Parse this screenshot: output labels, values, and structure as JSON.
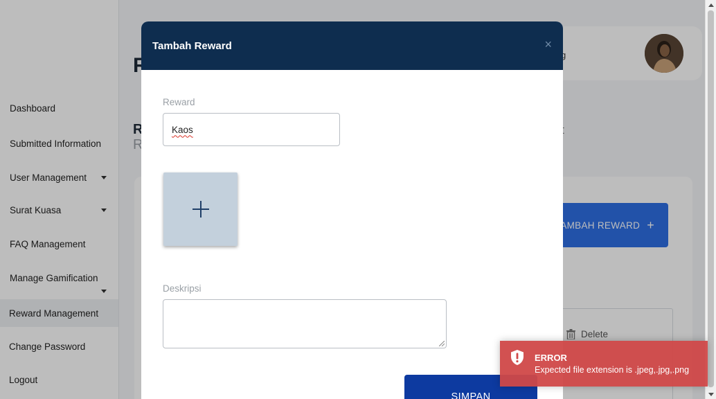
{
  "sidebar": {
    "items": [
      {
        "label": "Dashboard",
        "has_caret": false
      },
      {
        "label": "Submitted Information",
        "has_caret": false
      },
      {
        "label": "User Management",
        "has_caret": true
      },
      {
        "label": "Surat Kuasa",
        "has_caret": true
      },
      {
        "label": "FAQ Management",
        "has_caret": false
      },
      {
        "label": "Manage Gamification",
        "has_caret": true
      },
      {
        "label": "Reward Management",
        "has_caret": false,
        "active": true
      },
      {
        "label": "Change Password",
        "has_caret": false
      },
      {
        "label": "Logout",
        "has_caret": false
      }
    ]
  },
  "header": {
    "name_fragment": "g"
  },
  "page": {
    "title_fragment": "R",
    "section_fragment_1": "R",
    "section_fragment_2": "R",
    "right_fragment": "t"
  },
  "background": {
    "add_button_label": "AMBAH REWARD",
    "add_button_icon": "plus-icon",
    "delete_label": "Delete",
    "delete_icon": "trash-icon"
  },
  "modal": {
    "title": "Tambah Reward",
    "close_symbol": "×",
    "reward_label": "Reward",
    "reward_value": "Kaos",
    "upload_icon": "plus-icon",
    "description_label": "Deskripsi",
    "description_value": "",
    "submit_label": "SIMPAN"
  },
  "toast": {
    "title": "ERROR",
    "message": "Expected file extension is .jpeg,.jpg,.png",
    "icon": "shield-alert-icon"
  },
  "colors": {
    "modal_header": "#0e2d4f",
    "primary_button": "#0d3aa0",
    "accent_button": "#2f6fe4",
    "error": "#d04848",
    "upload_box": "#c3d0dc"
  }
}
